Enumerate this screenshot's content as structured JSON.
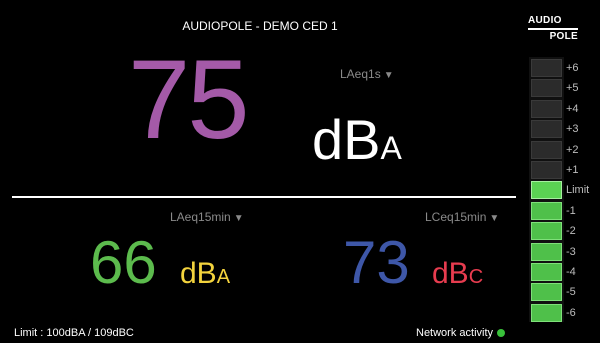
{
  "header": {
    "title": "AUDIOPOLE - DEMO CED 1",
    "logo_top": "AUDIO",
    "logo_bottom": "POLE"
  },
  "main": {
    "selector_label": "LAeq1s",
    "value": "75",
    "unit": "dB",
    "unit_sub": "A",
    "value_color": "#a45aa8"
  },
  "bottom_left": {
    "selector_label": "LAeq15min",
    "value": "66",
    "unit": "dB",
    "unit_sub": "A",
    "value_color": "#5cbb4d",
    "unit_color": "#f3d33d"
  },
  "bottom_right": {
    "selector_label": "LCeq15min",
    "value": "73",
    "unit": "dB",
    "unit_sub": "C",
    "value_color": "#3e57a8",
    "unit_color": "#e73c4f"
  },
  "footer": {
    "limit_text": "Limit : 100dBA / 109dBC",
    "network_label": "Network activity",
    "network_status_color": "#39c13b"
  },
  "meter": {
    "labels": [
      "+6",
      "+5",
      "+4",
      "+3",
      "+2",
      "+1",
      "Limit",
      "-1",
      "-2",
      "-3",
      "-4",
      "-5",
      "-6"
    ],
    "lit_segments": 7,
    "lit_color": "#4fc04a"
  },
  "icons": {
    "selector_arrow": "▼"
  }
}
